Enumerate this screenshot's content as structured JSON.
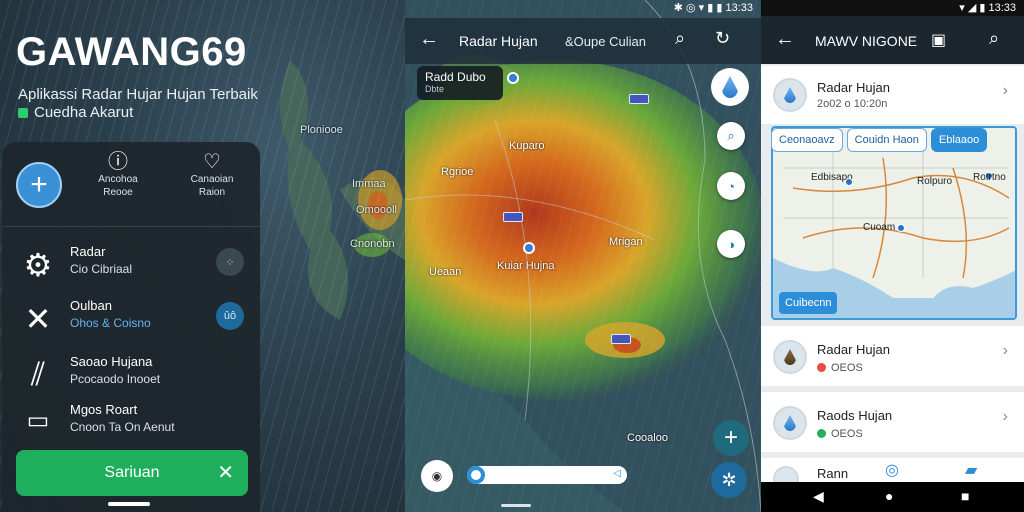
{
  "panel1": {
    "title": "GAWANG69",
    "subtitle_line1": "Aplikassi Radar Hujar Hujan Terbaik",
    "subtitle_line2": "Cuedha Akarut",
    "map_labels": [
      "Ploniooe",
      "Immaa",
      "Omoooll",
      "Cnonobn"
    ],
    "quick_actions": [
      {
        "icon": "info-icon",
        "line1": "Ancohoa",
        "line2": "Reooe"
      },
      {
        "icon": "heart-icon",
        "line1": "Canaoian",
        "line2": "Raion"
      }
    ],
    "menu": [
      {
        "icon": "gear-icon",
        "title": "Radar",
        "sub": "Cio Cibriaal"
      },
      {
        "icon": "satellite-icon",
        "title": "Oulban",
        "sub": "Ohos & Coisno",
        "badge": "ûô"
      },
      {
        "icon": "rain-icon",
        "title": "Saoao Hujana",
        "sub": "Pcocaodo Inooet"
      },
      {
        "icon": "folder-icon",
        "title": "Mgos Roart",
        "sub": "Cnoon Ta On Aenut"
      }
    ],
    "action_button": "Sariuan"
  },
  "panel2": {
    "status_time": "13:33",
    "title": "Radar Hujan",
    "subtitle": "&Oupe Culian",
    "location_chip": {
      "name": "Radd Dubo",
      "sub": "Dbte"
    },
    "cities": [
      "Kuparo",
      "Rgrioe",
      "Kuiar Hujna",
      "Mrigan",
      "Ueaan",
      "Cooaloo"
    ],
    "timeline_progress": 0.0
  },
  "panel3": {
    "status_time": "13:33",
    "title": "MAWV NIGONE",
    "items": [
      {
        "title": "Radar Hujan",
        "sub": "2o02 o 10:20n"
      },
      {
        "title": "Radar Hujan",
        "sub": "OEOS",
        "dot": "#e74c3c"
      },
      {
        "title": "Raods Hujan",
        "sub": "OEOS",
        "dot": "#27ae60"
      },
      {
        "title": "Rann",
        "sub": ""
      }
    ],
    "chips": [
      "Ceonaoavz",
      "Couidn Haon",
      "Eblaaoo"
    ],
    "map_labels": [
      "Edbisapo",
      "Rolpuro",
      "Cuoam",
      "Rotrtno"
    ],
    "map_button": "Cuibecnn"
  },
  "colors": {
    "accent": "#2d8fd6",
    "green": "#1fae5b"
  }
}
